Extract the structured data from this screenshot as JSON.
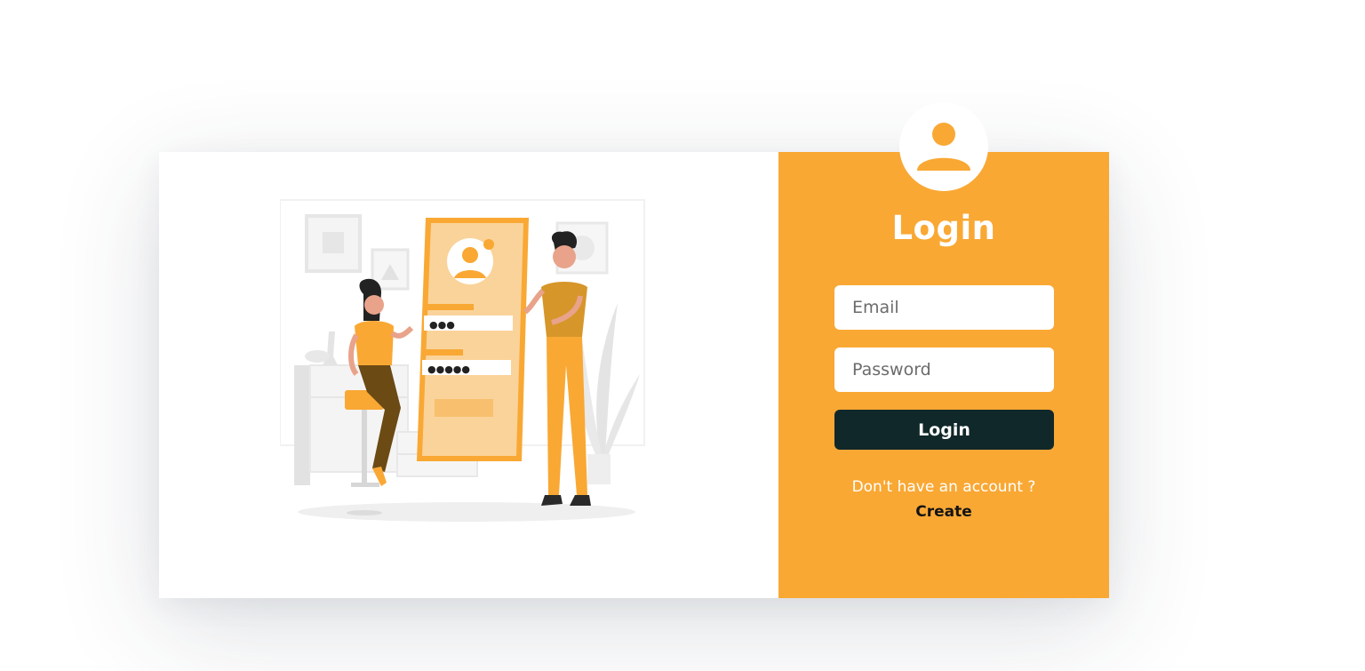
{
  "colors": {
    "accent": "#f9a834",
    "button": "#11282a",
    "card_left": "#ffffff"
  },
  "illustration": {
    "name": "login-illustration",
    "password_dots_top": "●●●",
    "password_dots_bottom": "●●●●●"
  },
  "login": {
    "avatar_icon": "user-icon",
    "title": "Login",
    "email_placeholder": "Email",
    "password_placeholder": "Password",
    "button_label": "Login",
    "prompt_text": "Don't have an account ?",
    "create_link": "Create"
  }
}
